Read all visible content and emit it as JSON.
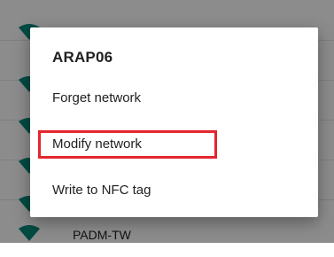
{
  "background_list": {
    "items": [
      {
        "label": ""
      },
      {
        "label": ""
      },
      {
        "label": ""
      },
      {
        "label": ""
      },
      {
        "label": ""
      },
      {
        "label": "PADM-TW"
      }
    ]
  },
  "dialog": {
    "title": "ARAP06",
    "options": [
      {
        "label": "Forget network"
      },
      {
        "label": "Modify network"
      },
      {
        "label": "Write to NFC tag"
      }
    ],
    "highlighted_option": "Modify network"
  },
  "colors": {
    "accent": "#00897b",
    "highlight": "#e3262d",
    "scrim": "rgba(0,0,0,0.45)"
  },
  "icons": {
    "network": "wifi-signal-icon"
  }
}
